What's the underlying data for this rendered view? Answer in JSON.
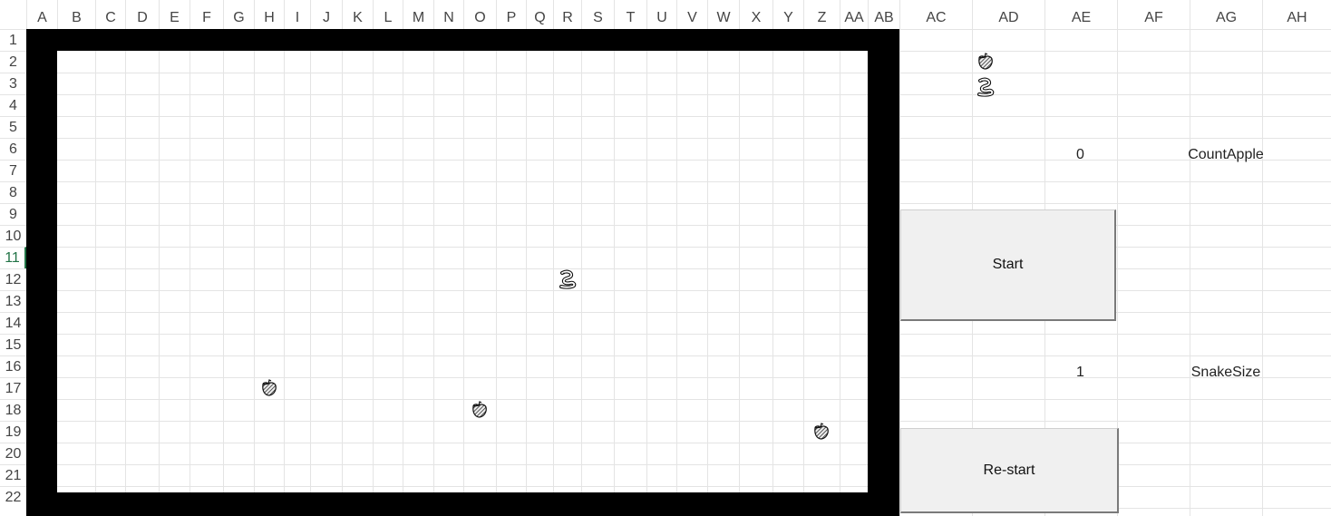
{
  "columns": [
    "A",
    "B",
    "C",
    "D",
    "E",
    "F",
    "G",
    "H",
    "I",
    "J",
    "K",
    "L",
    "M",
    "N",
    "O",
    "P",
    "Q",
    "R",
    "S",
    "T",
    "U",
    "V",
    "W",
    "X",
    "Y",
    "Z",
    "AA",
    "AB",
    "AC",
    "AD",
    "AE",
    "AF",
    "AG",
    "AH"
  ],
  "rows": [
    "1",
    "2",
    "3",
    "4",
    "5",
    "6",
    "7",
    "8",
    "9",
    "10",
    "11",
    "12",
    "13",
    "14",
    "15",
    "16",
    "17",
    "18",
    "19",
    "20",
    "21",
    "22"
  ],
  "active_row": "11",
  "icons": {
    "apple": "apple-icon",
    "snake": "snake-icon"
  },
  "legend": {
    "apple_row": "2",
    "snake_row": "3",
    "column": "AD"
  },
  "game": {
    "snake_cell": "R12",
    "apple_cells": [
      "H17",
      "O18",
      "Z19"
    ]
  },
  "stats": {
    "count_apple_value": "0",
    "count_apple_label": "CountApple",
    "snake_size_value": "1",
    "snake_size_label": "SnakeSize"
  },
  "buttons": {
    "start_label": "Start",
    "restart_label": "Re-start"
  },
  "colors": {
    "frame": "#000000",
    "gridline": "#e4e4e4",
    "button_face": "#f0f0f0",
    "active_header": "#217346"
  }
}
